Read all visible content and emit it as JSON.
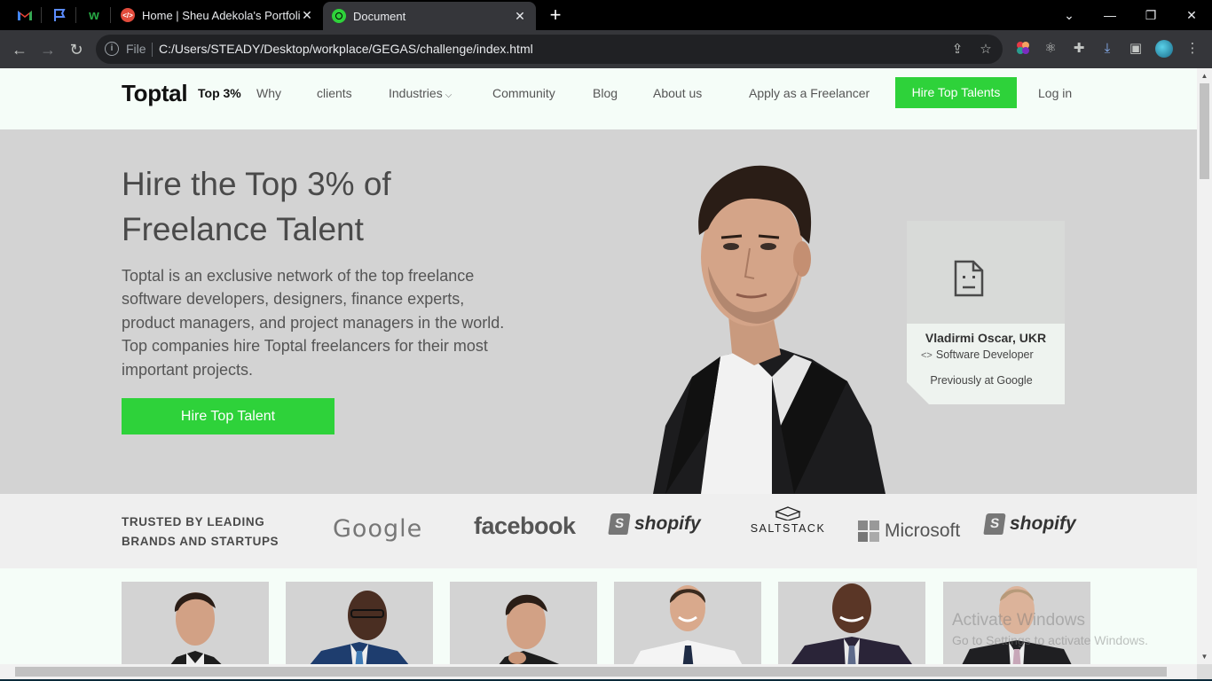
{
  "browser": {
    "tabs": [
      {
        "title": "Home | Sheu Adekola's Portfolio",
        "favicon": "code-icon",
        "active": false
      },
      {
        "title": "Document",
        "favicon": "document-icon",
        "active": true
      }
    ],
    "pinned": [
      "gmail-icon",
      "flag-icon",
      "wattpad-icon"
    ],
    "close_glyph": "✕",
    "address": {
      "scheme_label": "File",
      "url": "C:/Users/STEADY/Desktop/workplace/GEGAS/challenge/index.html"
    }
  },
  "site": {
    "logo": "Toptal",
    "badge": "Top 3%",
    "nav": [
      "Why",
      "clients",
      "Industries",
      "Community",
      "Blog",
      "About us",
      "Apply as a Freelancer"
    ],
    "hire_button": "Hire Top Talents",
    "login": "Log in",
    "hero": {
      "title": "Hire the Top 3% of Freelance Talent",
      "text": "Toptal is an exclusive network of the top freelance software developers, designers, finance experts, product managers, and project managers in the world. Top companies hire Toptal freelancers for their most important projects.",
      "cta": "Hire Top Talent"
    },
    "profile": {
      "name": "Vladirmi Oscar, UKR",
      "role_icon": "<>",
      "role": "Software Developer",
      "previous": "Previously at Google"
    },
    "trusted": {
      "label_line1": "TRUSTED BY LEADING",
      "label_line2": "BRANDS AND STARTUPS",
      "brands": [
        "Google",
        "facebook",
        "shopify",
        "SALTSTACK",
        "Microsoft",
        "shopify"
      ]
    },
    "talent_count": 6
  },
  "os_overlay": {
    "line1": "Activate Windows",
    "line2": "Go to Settings to activate Windows."
  },
  "colors": {
    "accent_green": "#2ed23a",
    "hero_bg": "#d3d3d3",
    "page_bg": "#f5fdf8"
  }
}
